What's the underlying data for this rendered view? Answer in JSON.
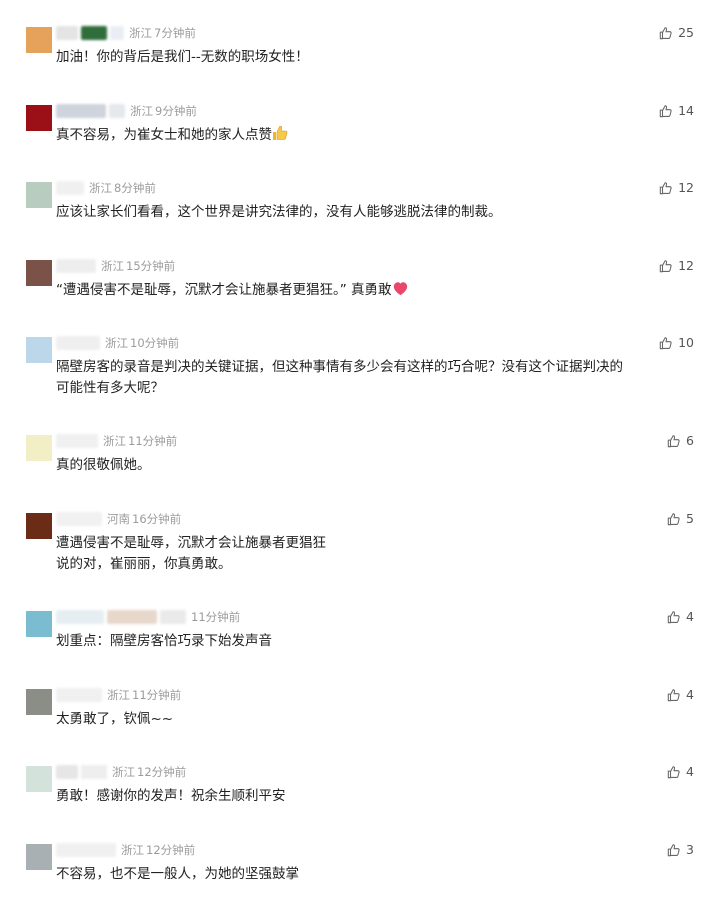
{
  "comments": [
    {
      "location": "浙江",
      "time": "7分钟前",
      "text": "加油！你的背后是我们--无数的职场女性！",
      "likes": "25",
      "avatar_color": "#e6a25a",
      "emoji": ""
    },
    {
      "location": "浙江",
      "time": "9分钟前",
      "text": "真不容易，为崔女士和她的家人点赞",
      "likes": "14",
      "avatar_color": "#9a1016",
      "emoji": "thumbs-up"
    },
    {
      "location": "浙江",
      "time": "8分钟前",
      "text": "应该让家长们看看，这个世界是讲究法律的，没有人能够逃脱法律的制裁。",
      "likes": "12",
      "avatar_color": "#b9ccc0",
      "emoji": ""
    },
    {
      "location": "浙江",
      "time": "15分钟前",
      "text": "“遭遇侵害不是耻辱，沉默才会让施暴者更猖狂。” 真勇敢",
      "likes": "12",
      "avatar_color": "#7a5248",
      "emoji": "heart"
    },
    {
      "location": "浙江",
      "time": "10分钟前",
      "text": "隔壁房客的录音是判决的关键证据，但这种事情有多少会有这样的巧合呢？没有这个证据判决的",
      "text2": "可能性有多大呢？",
      "likes": "10",
      "avatar_color": "#bcd6ea",
      "emoji": ""
    },
    {
      "location": "浙江",
      "time": "11分钟前",
      "text": "真的很敬佩她。",
      "likes": "6",
      "avatar_color": "#f2efc6",
      "emoji": ""
    },
    {
      "location": "河南",
      "time": "16分钟前",
      "text": "遭遇侵害不是耻辱，沉默才会让施暴者更猖狂",
      "text2": "说的对，崔丽丽，你真勇敢。",
      "likes": "5",
      "avatar_color": "#6a2c16",
      "emoji": ""
    },
    {
      "location": "",
      "time": "11分钟前",
      "text": "划重点：隔壁房客恰巧录下始发声音",
      "likes": "4",
      "avatar_color": "#7cbcd0",
      "emoji": ""
    },
    {
      "location": "浙江",
      "time": "11分钟前",
      "text": "太勇敢了，钦佩~~",
      "likes": "4",
      "avatar_color": "#8a8e86",
      "emoji": ""
    },
    {
      "location": "浙江",
      "time": "12分钟前",
      "text": "勇敢！感谢你的发声！祝余生顺利平安",
      "likes": "4",
      "avatar_color": "#d4e2dc",
      "emoji": ""
    },
    {
      "location": "浙江",
      "time": "12分钟前",
      "text": "不容易，也不是一般人，为她的坚强鼓掌",
      "likes": "3",
      "avatar_color": "#a8b0b4",
      "emoji": ""
    }
  ]
}
